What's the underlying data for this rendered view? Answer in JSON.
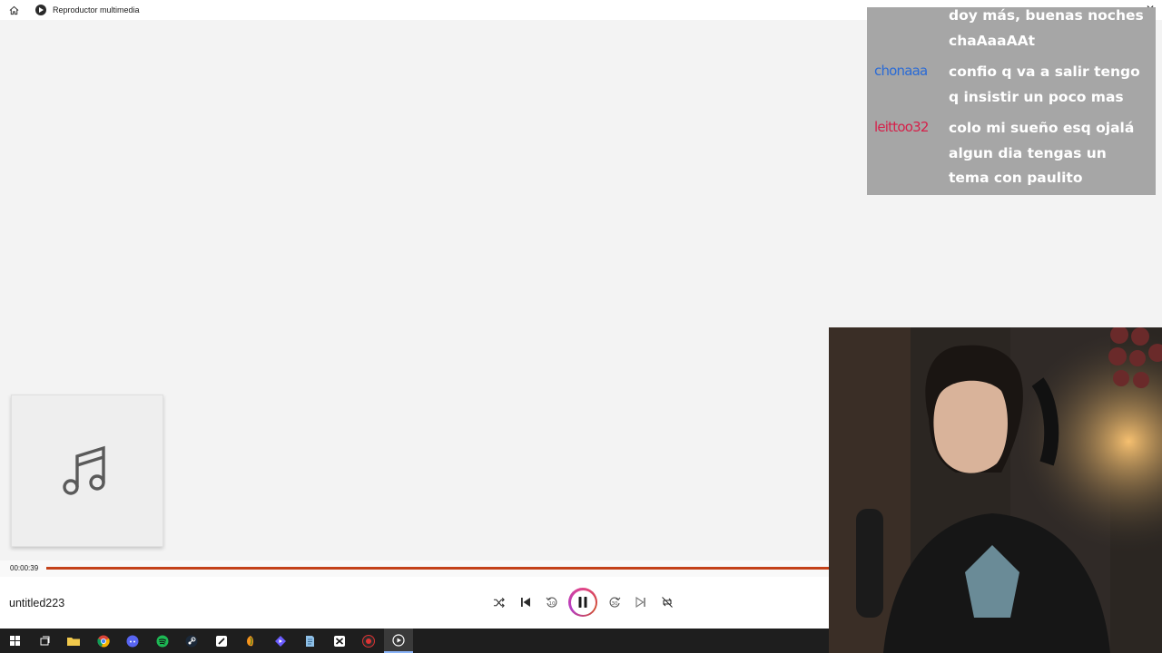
{
  "window": {
    "title": "Reproductor multimedia",
    "home_icon": "home-icon",
    "app_icon": "media-player-icon"
  },
  "album_art": {
    "icon": "music-note-icon"
  },
  "playback": {
    "elapsed": "00:00:39",
    "progress_fraction": 1.0,
    "accent_color": "#c4421a"
  },
  "track": {
    "title": "untitled223"
  },
  "controls": [
    {
      "name": "shuffle-button",
      "icon": "shuffle-icon"
    },
    {
      "name": "previous-button",
      "icon": "skip-previous-icon"
    },
    {
      "name": "rewind-10-button",
      "icon": "rewind-10-icon"
    },
    {
      "name": "pause-button",
      "icon": "pause-icon"
    },
    {
      "name": "forward-30-button",
      "icon": "forward-30-icon"
    },
    {
      "name": "next-button",
      "icon": "skip-next-icon"
    },
    {
      "name": "repeat-button",
      "icon": "repeat-off-icon"
    }
  ],
  "chat": {
    "messages": [
      {
        "user": "",
        "text": "doy más, buenas noches chaAaaAAt",
        "user_color": ""
      },
      {
        "user": "chonaaa",
        "text": "confio q va a salir tengo q insistir un poco mas",
        "user_color": "#2a6bd6"
      },
      {
        "user": "leittoo32",
        "text": "colo mi sueño esq ojalá algun dia tengas un tema con paulito",
        "user_color": "#d6204a"
      }
    ]
  },
  "taskbar": {
    "items": [
      {
        "name": "start-button",
        "icon": "windows-icon"
      },
      {
        "name": "task-view-button",
        "icon": "task-view-icon"
      },
      {
        "name": "file-explorer-button",
        "icon": "folder-icon"
      },
      {
        "name": "chrome-button",
        "icon": "chrome-icon"
      },
      {
        "name": "discord-button",
        "icon": "discord-icon"
      },
      {
        "name": "spotify-button",
        "icon": "spotify-icon"
      },
      {
        "name": "steam-button",
        "icon": "steam-icon"
      },
      {
        "name": "app-button",
        "icon": "app-icon"
      },
      {
        "name": "fl-studio-button",
        "icon": "fl-studio-icon"
      },
      {
        "name": "app-button-2",
        "icon": "diamond-app-icon"
      },
      {
        "name": "notepad-button",
        "icon": "notepad-icon"
      },
      {
        "name": "capcut-button",
        "icon": "capcut-icon"
      },
      {
        "name": "obs-button",
        "icon": "record-icon"
      },
      {
        "name": "media-player-button",
        "icon": "media-player-icon"
      }
    ]
  }
}
